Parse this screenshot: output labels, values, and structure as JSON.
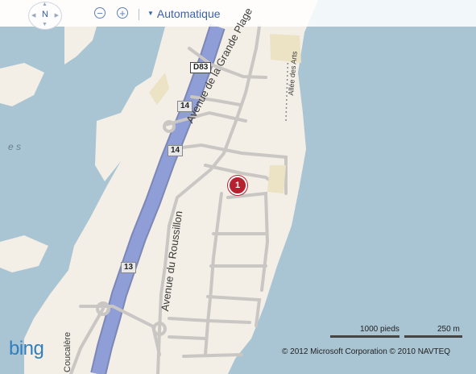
{
  "toolbar": {
    "compass_label": "N",
    "zoom_out_icon": "zoom-out-icon",
    "zoom_in_icon": "zoom-in-icon",
    "map_style_label": "Automatique"
  },
  "map": {
    "roads": {
      "avenue_grande_plage": "Avenue de la Grande Plage",
      "avenue_roussillon": "Avenue du Roussillon",
      "allee_des_arts": "Allée des Arts",
      "coucalere": "Coucalère"
    },
    "shields": {
      "d83": "D83",
      "a14_top": "14",
      "a14_mid": "14",
      "a13": "13"
    },
    "partial_label": "e s",
    "pin_label": "1"
  },
  "scale": {
    "feet_label": "1000 pieds",
    "meters_label": "250 m"
  },
  "copyright": "© 2012 Microsoft Corporation   © 2010 NAVTEQ",
  "logo": "bing",
  "colors": {
    "water": "#a9c5d3",
    "land": "#f3efe6",
    "highway": "#8f9ed6",
    "pin": "#b7202e",
    "brand": "#2e7fc0"
  }
}
